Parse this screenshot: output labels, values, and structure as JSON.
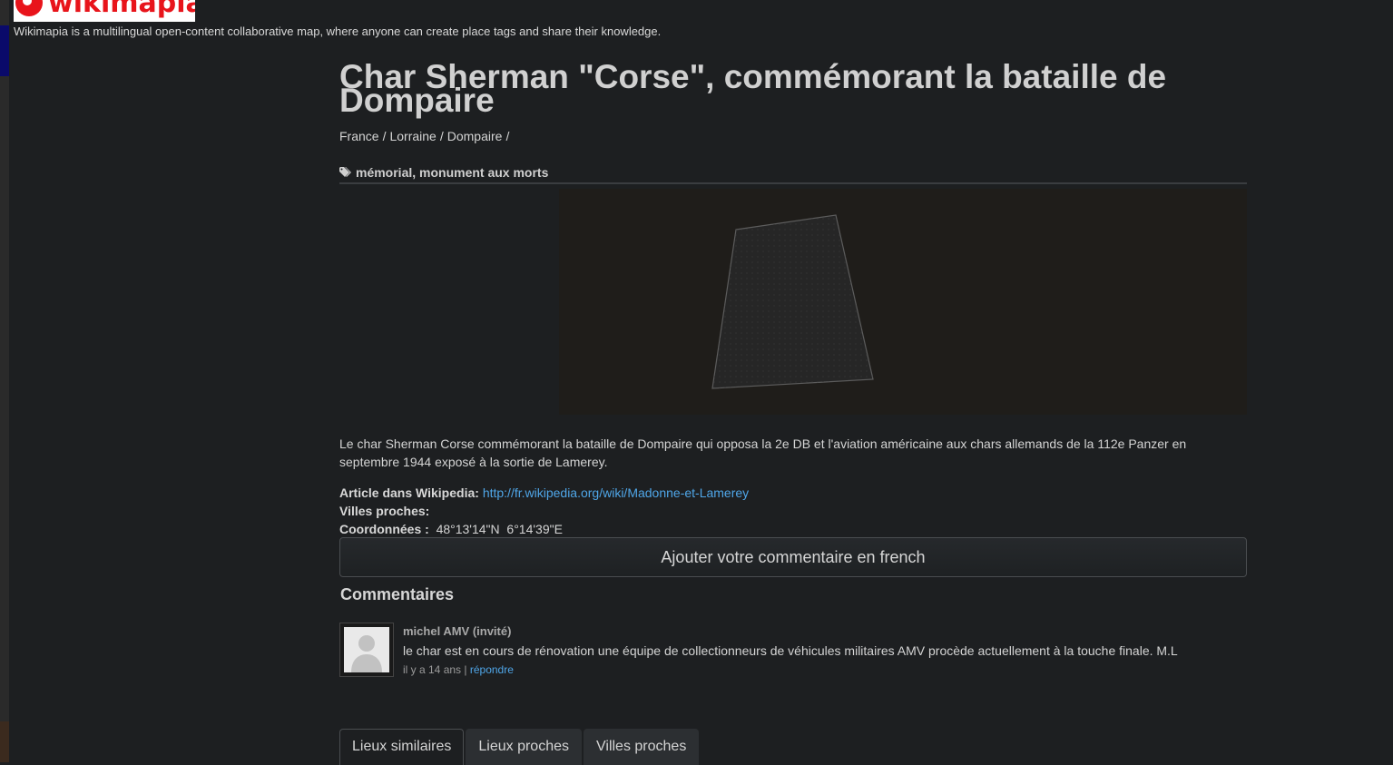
{
  "brand": {
    "logo_text": "wikimapia",
    "tagline": "Wikimapia is a multilingual open-content collaborative map, where anyone can create place tags and share their knowledge."
  },
  "place": {
    "title": "Char Sherman \"Corse\", commémorant la bataille de Dompaire",
    "breadcrumb": [
      "France",
      "Lorraine",
      "Dompaire"
    ],
    "tags": "mémorial, monument aux morts",
    "description": "Le char Sherman Corse commémorant la bataille de Dompaire qui opposa la 2e DB et l'aviation américaine aux chars allemands de la 112e Panzer en septembre 1944 exposé à la sortie de Lamerey."
  },
  "info": {
    "wikipedia_label": "Article dans Wikipedia:",
    "wikipedia_url": "http://fr.wikipedia.org/wiki/Madonne-et-Lamerey",
    "nearby_cities_label": "Villes proches:",
    "coords_label": "Coordonnées :",
    "lat": "48°13'14\"N",
    "lon": "6°14'39\"E"
  },
  "add_comment_label": "Ajouter votre commentaire en french",
  "comments": {
    "heading": "Commentaires",
    "items": [
      {
        "author": "michel AMV (invité)",
        "text": "le char est en cours de rénovation une équipe de collectionneurs de véhicules militaires AMV procède actuellement à la touche finale. M.L",
        "time": "il y a 14 ans",
        "reply_label": "répondre"
      }
    ]
  },
  "tabs": [
    {
      "label": "Lieux similaires",
      "active": true
    },
    {
      "label": "Lieux proches",
      "active": false
    },
    {
      "label": "Villes proches",
      "active": false
    }
  ],
  "colors": {
    "background": "#1d1f21",
    "link": "#4fa6e8",
    "brand_red": "#e8141b"
  }
}
